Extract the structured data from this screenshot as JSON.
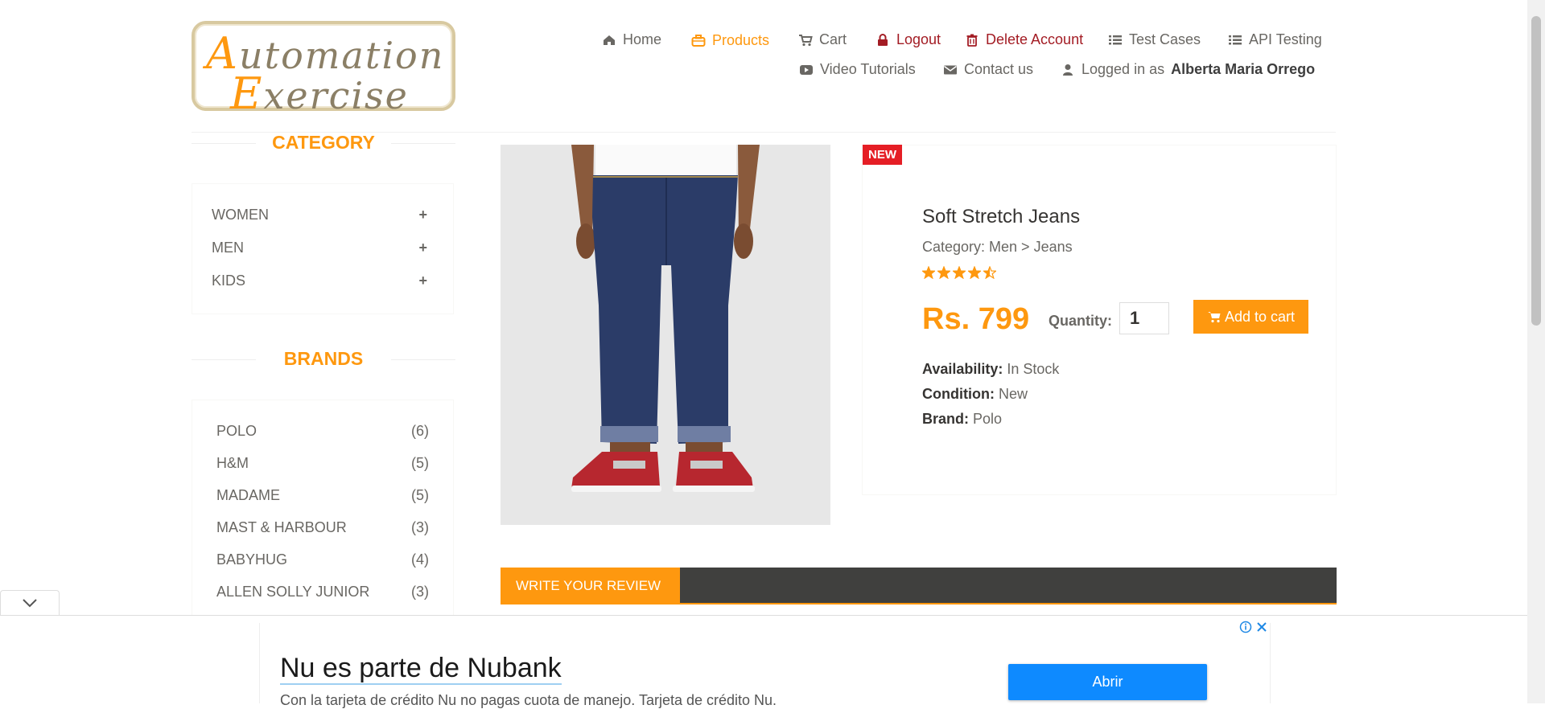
{
  "logo": {
    "line1_cap": "A",
    "line1_rest": "utomation",
    "line2_cap": "E",
    "line2_rest": "xercise"
  },
  "nav": {
    "home": "Home",
    "products": "Products",
    "cart": "Cart",
    "logout": "Logout",
    "delete_account": "Delete Account",
    "test_cases": "Test Cases",
    "api_testing": "API Testing",
    "video_tutorials": "Video Tutorials",
    "contact_us": "Contact us",
    "logged_in_prefix": "Logged in as",
    "logged_in_user": "Alberta Maria Orrego"
  },
  "sidebar": {
    "category_title": "CATEGORY",
    "categories": [
      {
        "label": "WOMEN",
        "icon": "+"
      },
      {
        "label": "MEN",
        "icon": "+"
      },
      {
        "label": "KIDS",
        "icon": "+"
      }
    ],
    "brands_title": "BRANDS",
    "brands": [
      {
        "name": "POLO",
        "count": "(6)"
      },
      {
        "name": "H&M",
        "count": "(5)"
      },
      {
        "name": "MADAME",
        "count": "(5)"
      },
      {
        "name": "MAST & HARBOUR",
        "count": "(3)"
      },
      {
        "name": "BABYHUG",
        "count": "(4)"
      },
      {
        "name": "ALLEN SOLLY JUNIOR",
        "count": "(3)"
      }
    ]
  },
  "product": {
    "badge": "NEW",
    "name": "Soft Stretch Jeans",
    "category": "Category: Men > Jeans",
    "rating": 4.5,
    "price": "Rs. 799",
    "quantity_label": "Quantity:",
    "quantity_value": "1",
    "add_to_cart": "Add to cart",
    "availability_label": "Availability:",
    "availability": "In Stock",
    "condition_label": "Condition:",
    "condition": "New",
    "brand_label": "Brand:",
    "brand": "Polo"
  },
  "review": {
    "tab_label": "WRITE YOUR REVIEW"
  },
  "ad": {
    "headline": "Nu es parte de Nubank",
    "body": "Con la tarjeta de crédito Nu no pagas cuota de manejo. Tarjeta de crédito Nu.",
    "button": "Abrir"
  },
  "colors": {
    "accent": "#fe980f",
    "danger": "#a31c24",
    "badge": "#e51e25",
    "ad_button": "#0e8aff"
  }
}
